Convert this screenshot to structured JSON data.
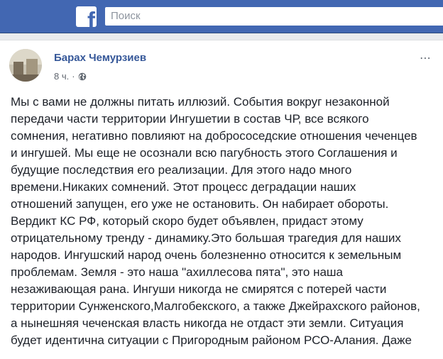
{
  "header": {
    "logo_letter": "f",
    "search_placeholder": "Поиск"
  },
  "post": {
    "author": "Барах Чемурзиев",
    "time": "8 ч.",
    "separator": "·",
    "more_icon": "⋯",
    "lines": [
      "Мы с вами не должны питать иллюзий. События вокруг незаконной",
      "передачи части территории Ингушетии в состав ЧР, все всякого",
      "сомнения, негативно повлияют на добрососедские отношения чеченцев",
      "и ингушей. Мы еще не осознали всю пагубность этого Соглашения и",
      "будущие последствия его реализации. Для этого надо много",
      "времени.Никаких сомнений. Этот процесс деградации наших",
      "отношений запущен, его уже не остановить. Он набирает обороты.",
      "Вердикт КС РФ, который скоро будет объявлен, придаст этому",
      "отрицательному тренду - динамику.Это большая трагедия для наших",
      "народов. Ингушский народ очень болезненно относится к земельным",
      "проблемам. Земля - это наша \"ахиллесова пята\", это наша",
      "незаживающая рана. Ингуши никогда не смирятся с потерей части",
      "территории Сунженского,Малгобекского, а также Джейрахского районов,",
      "а нынешняя чеченская власть никогда не отдаст эти земли. Ситуация",
      "будет идентична ситуации с Пригородным районом РСО-Алания. Даже"
    ]
  },
  "colors": {
    "brand": "#4267b2",
    "author_link": "#365899",
    "text": "#1d2129",
    "meta": "#616770",
    "page_bg": "#e9ebee"
  }
}
